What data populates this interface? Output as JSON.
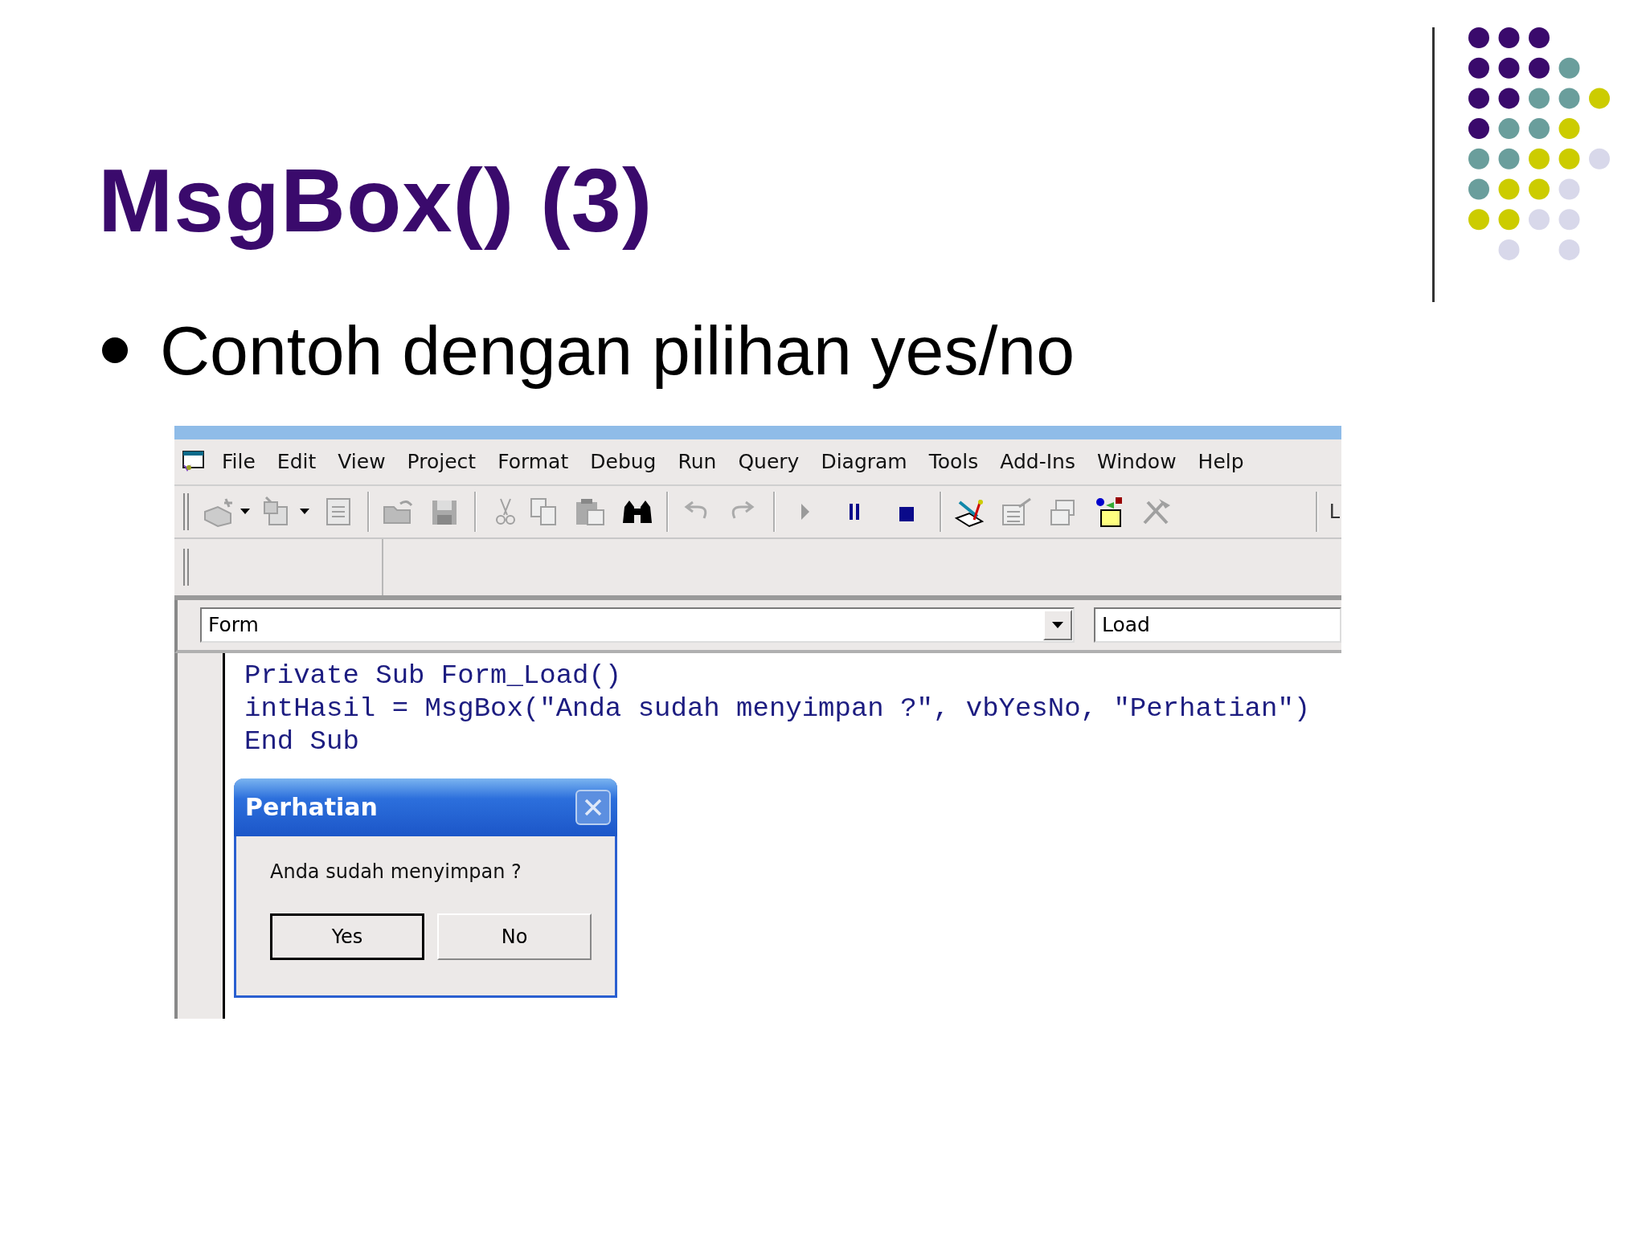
{
  "slide": {
    "title": "MsgBox() (3)",
    "bullets": [
      "Contoh dengan pilihan yes/no"
    ]
  },
  "ide": {
    "menu": [
      {
        "label": "File"
      },
      {
        "label": "Edit"
      },
      {
        "label": "View"
      },
      {
        "label": "Project"
      },
      {
        "label": "Format"
      },
      {
        "label": "Debug"
      },
      {
        "label": "Run"
      },
      {
        "label": "Query"
      },
      {
        "label": "Diagram"
      },
      {
        "label": "Tools"
      },
      {
        "label": "Add-Ins"
      },
      {
        "label": "Window"
      },
      {
        "label": "Help"
      }
    ],
    "toolbar_text": "L",
    "object_combo": {
      "value": "Form"
    },
    "procedure_combo": {
      "value": "Load"
    },
    "code_lines": [
      "Private Sub Form_Load()",
      "intHasil = MsgBox(\"Anda sudah menyimpan ?\", vbYesNo, \"Perhatian\")",
      "End Sub"
    ]
  },
  "dialog": {
    "title": "Perhatian",
    "message": "Anda sudah menyimpan ?",
    "buttons": [
      {
        "label": "Yes",
        "default": true
      },
      {
        "label": "No",
        "default": false
      }
    ]
  }
}
